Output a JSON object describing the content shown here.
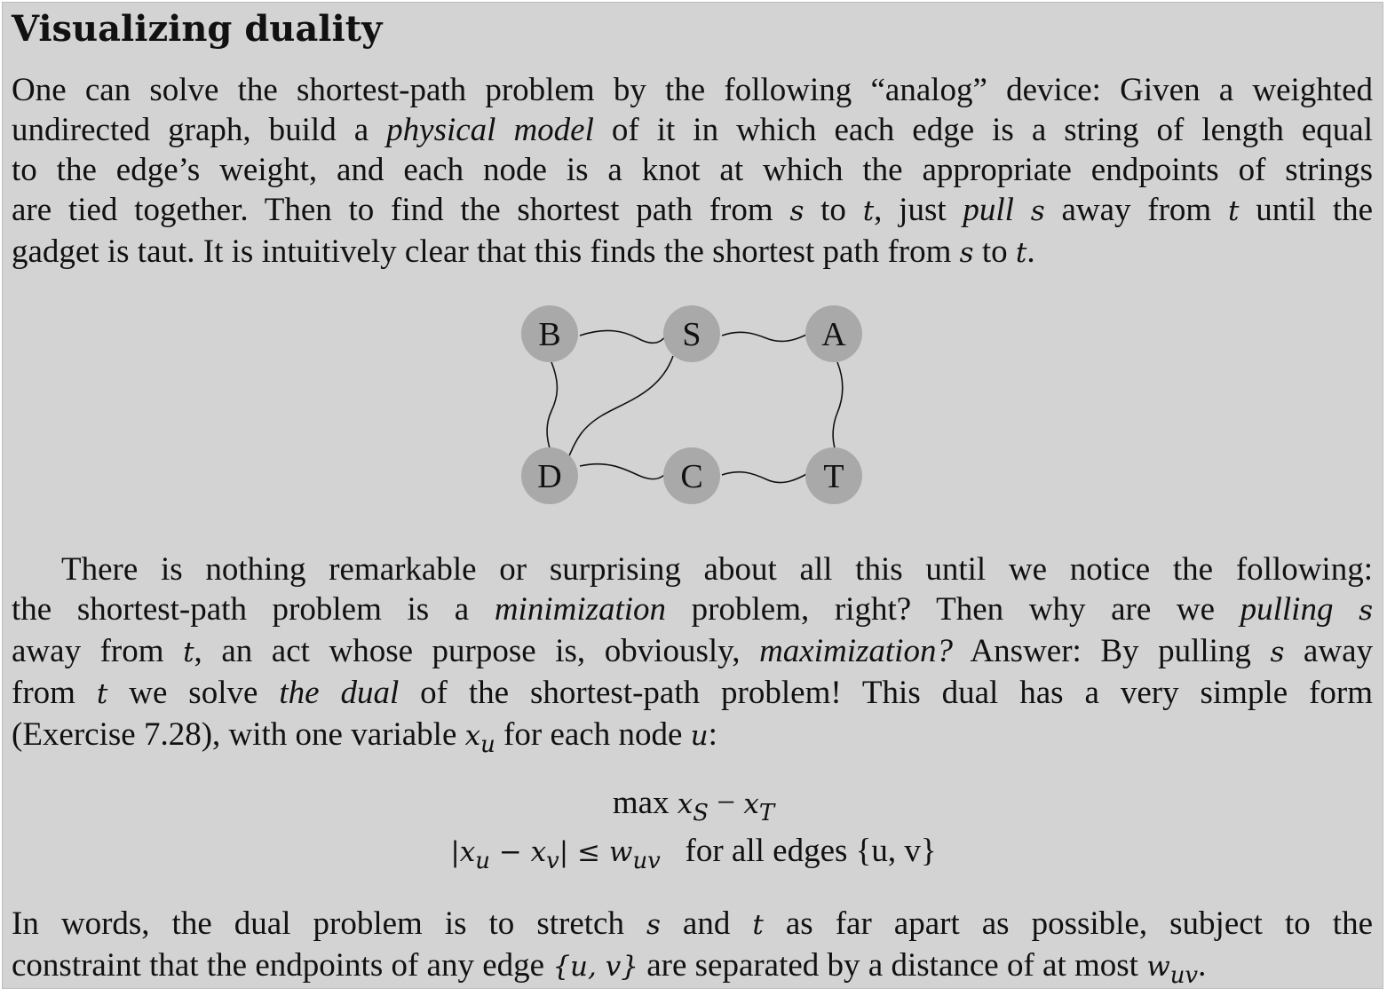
{
  "title": "Visualizing duality",
  "para1": {
    "l1": "One can solve the shortest-path problem by the following “analog” device: Given a weighted",
    "l2a": "undirected graph, build a ",
    "l2em": "physical model",
    "l2b": " of it in which each edge is a string of length equal",
    "l3": "to the edge’s weight, and each node is a knot at which the appropriate endpoints of strings",
    "l4a": "are tied together. Then to find the shortest path from ",
    "l4b": " to ",
    "l4c": ", just ",
    "l4em": "pull",
    "l4d": " away from ",
    "l4e": " until the",
    "l5a": "gadget is taut. It is intuitively clear that this finds the shortest path from ",
    "l5b": " to ",
    "l5c": ".",
    "s": "s",
    "t": "t"
  },
  "graph": {
    "nodes": {
      "B": "B",
      "S": "S",
      "A": "A",
      "D": "D",
      "C": "C",
      "T": "T"
    }
  },
  "para2": {
    "l1": "There is nothing remarkable or surprising about all this until we notice the following:",
    "l2a": "the shortest-path problem is a ",
    "l2em1": "minimization",
    "l2b": " problem, right?  Then why are we ",
    "l2em2": "pulling",
    "l3a": "away from ",
    "l3b": ", an act whose purpose is, obviously, ",
    "l3em": "maximization?",
    "l3c": " Answer: By pulling ",
    "l3d": " away",
    "l4a": "from ",
    "l4b": " we solve ",
    "l4em": "the dual",
    "l4c": " of the shortest-path problem!  This dual has a very simple form",
    "l5a": "(Exercise 7.28), with one variable ",
    "l5b": " for each node ",
    "l5c": ":",
    "x": "x",
    "u": "u"
  },
  "equations": {
    "max": "max",
    "obj_x1": "x",
    "obj_s": "S",
    "obj_minus": " − ",
    "obj_x2": "x",
    "obj_t": "T",
    "con_lhs": "|x",
    "con_u": "u",
    "con_mid": " − x",
    "con_v": "v",
    "con_rhs": "| ≤ w",
    "con_uv": "uv",
    "con_text": "for all edges {u, v}"
  },
  "para3": {
    "l1a": "In words, the dual problem is to stretch ",
    "l1b": " and ",
    "l1c": " as far apart as possible, subject to the",
    "l2a": "constraint that the endpoints of any edge ",
    "l2set": "{u, v}",
    "l2b": " are separated by a distance of at most ",
    "l2w": "w",
    "l2uv": "uv",
    "l2c": "."
  }
}
